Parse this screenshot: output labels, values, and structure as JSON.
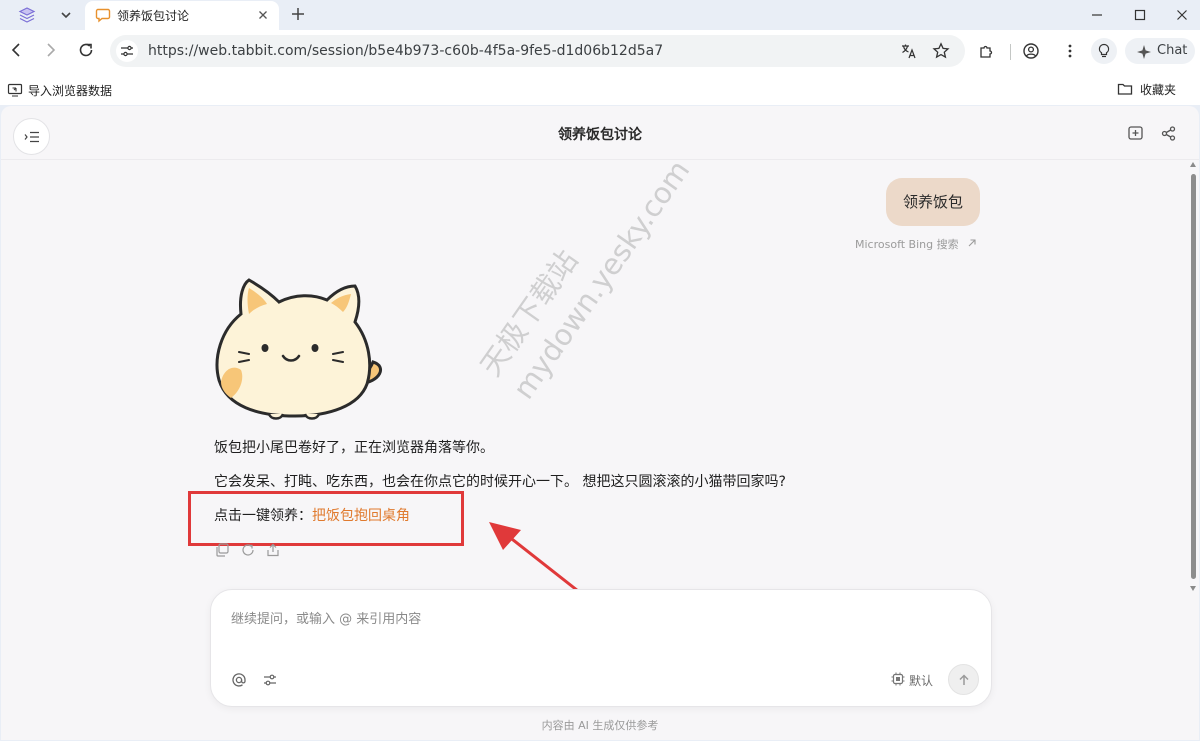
{
  "browser": {
    "tab": {
      "title": "领养饭包讨论"
    },
    "url": "https://web.tabbit.com/session/b5e4b973-c60b-4f5a-9fe5-d1d06b12d5a7",
    "chat_button": "Chat",
    "bookmarks": {
      "import_label": "导入浏览器数据",
      "folder_label": "收藏夹"
    }
  },
  "page": {
    "title": "领养饭包讨论",
    "user_message": "领养饭包",
    "source_link": "Microsoft Bing 搜索",
    "assistant": {
      "line1": "饭包把小尾巴卷好了，正在浏览器角落等你。",
      "line2": "它会发呆、打盹、吃东西，也会在你点它的时候开心一下。 想把这只圆滚滚的小猫带回家吗?",
      "line3_prefix": "点击一键领养：",
      "line3_link": "把饭包抱回桌角"
    },
    "composer": {
      "placeholder": "继续提问，或输入 @ 来引用内容",
      "model_label": "默认"
    },
    "disclaimer": "内容由 AI 生成仅供参考"
  },
  "watermark": {
    "line1": "天极下载站",
    "line2": "mydown.yesky.com"
  },
  "colors": {
    "accent_link": "#e07a2e",
    "user_bubble": "#ecd9c9",
    "annotation_red": "#e0393a"
  }
}
